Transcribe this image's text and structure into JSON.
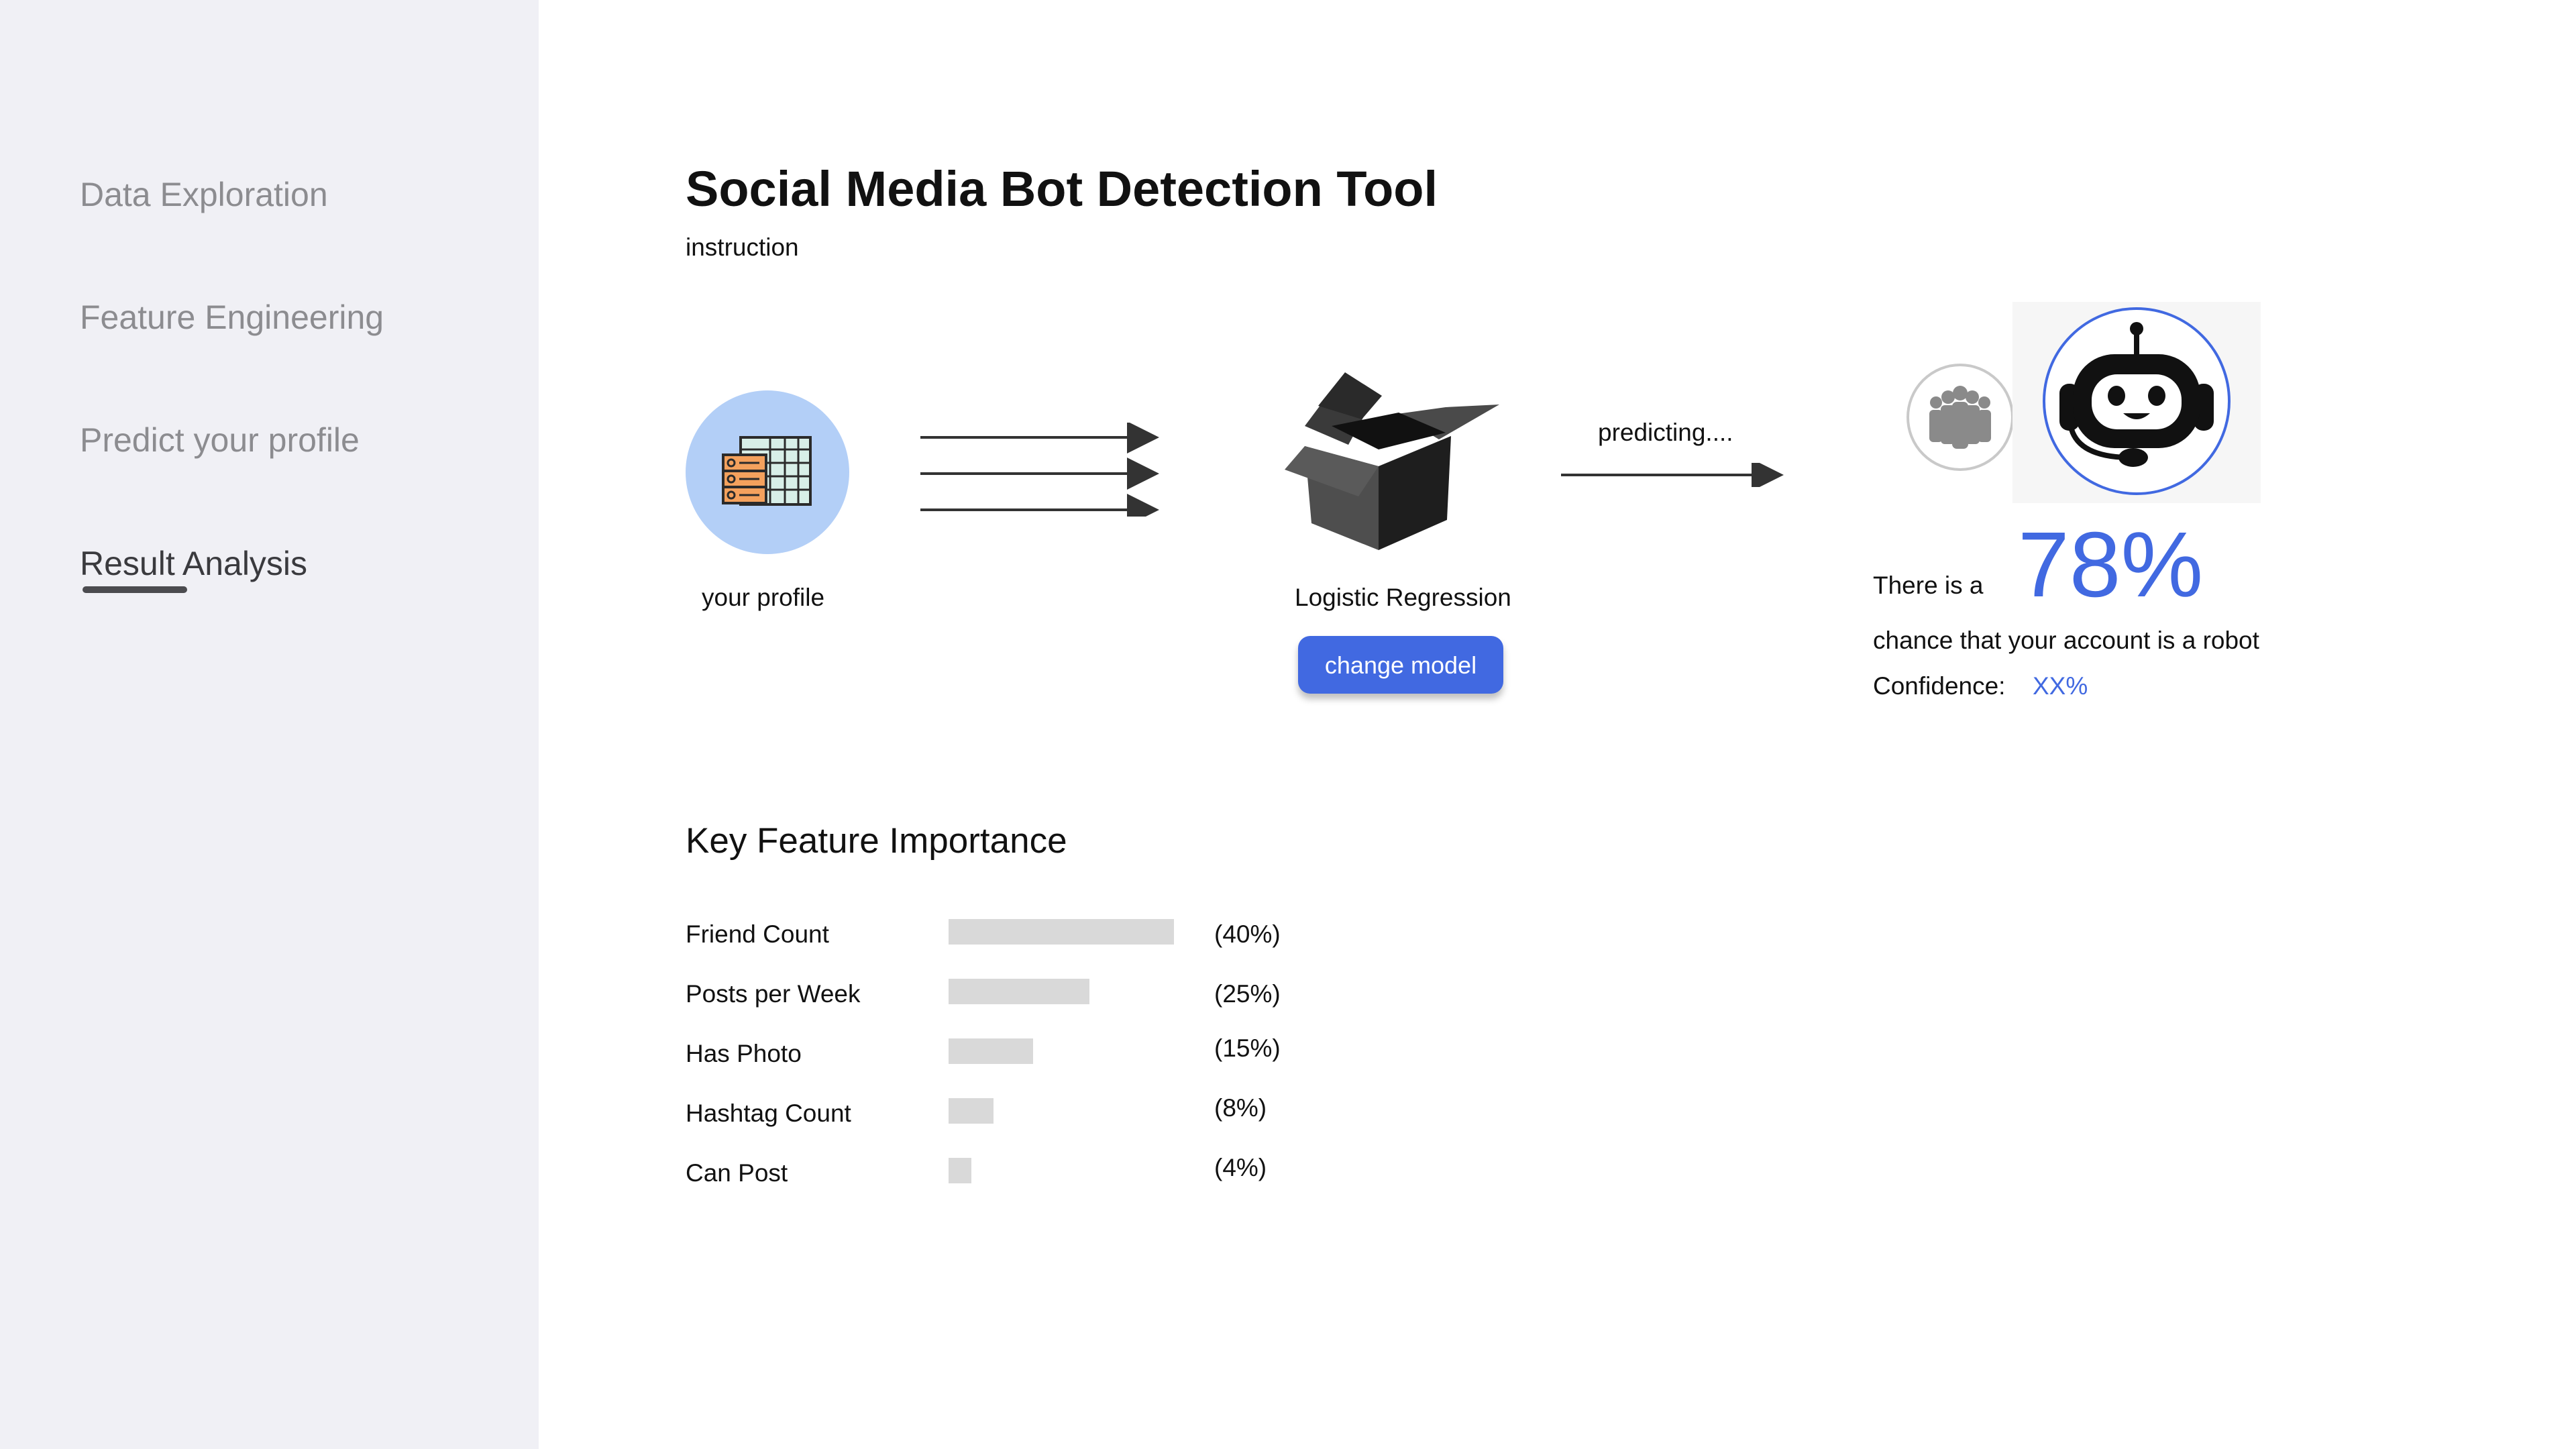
{
  "sidebar": {
    "items": [
      {
        "label": "Data Exploration",
        "active": false
      },
      {
        "label": "Feature Engineering",
        "active": false
      },
      {
        "label": "Predict your profile",
        "active": false
      },
      {
        "label": "Result Analysis",
        "active": true
      }
    ]
  },
  "header": {
    "title": "Social Media Bot Detection Tool",
    "instruction": "instruction"
  },
  "pipeline": {
    "profile_label": "your profile",
    "model_label": "Logistic Regression",
    "change_model_label": "change model",
    "predicting_label": "predicting...."
  },
  "result": {
    "prefix": "There is a",
    "percent": "78%",
    "suffix": "chance that your account is a robot",
    "confidence_label": "Confidence:",
    "confidence_value": "XX%"
  },
  "feature_importance": {
    "title": "Key Feature Importance",
    "items": [
      {
        "name": "Friend Count",
        "pct_label": "(40%)",
        "value": 40
      },
      {
        "name": "Posts per Week",
        "pct_label": "(25%)",
        "value": 25
      },
      {
        "name": "Has Photo",
        "pct_label": "(15%)",
        "value": 15
      },
      {
        "name": "Hashtag Count",
        "pct_label": "(8%)",
        "value": 8
      },
      {
        "name": "Can Post",
        "pct_label": "(4%)",
        "value": 4
      }
    ]
  },
  "colors": {
    "accent": "#4169e1",
    "sidebar_bg": "#f0f0f5",
    "profile_circle": "#b3cff7",
    "bar": "#d9d9d9"
  },
  "icons": {
    "profile": "spreadsheet-icon",
    "model": "open-box-icon",
    "human": "people-group-icon",
    "bot": "robot-headset-icon"
  }
}
